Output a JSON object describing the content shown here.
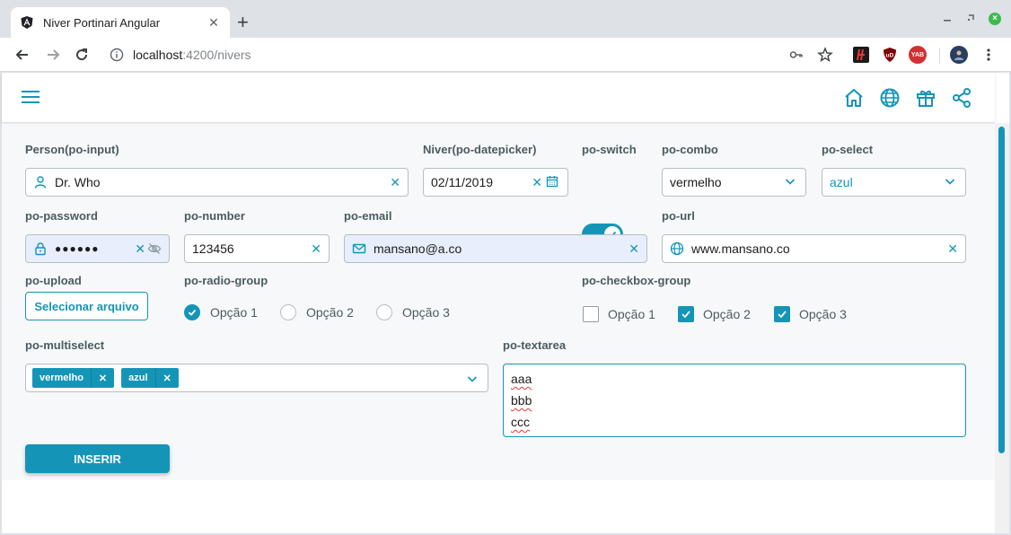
{
  "browser": {
    "tab_title": "Niver Portinari Angular",
    "tab_close": "✕",
    "new_tab": "+",
    "url_host": "localhost",
    "url_path": ":4200/nivers",
    "extensions": [
      "password-key",
      "bookmark-star",
      "ext-red",
      "ublock",
      "yab",
      "profile"
    ],
    "ext_ublock_text": "uD",
    "ext_yab_text": "YAB"
  },
  "header": {
    "icons": [
      "menu-icon",
      "home-icon",
      "globe-icon",
      "gift-icon",
      "share-icon"
    ]
  },
  "form": {
    "person": {
      "label": "Person(po-input)",
      "value": "Dr. Who"
    },
    "niver": {
      "label": "Niver(po-datepicker)",
      "value": "02/11/2019"
    },
    "switch": {
      "label": "po-switch",
      "on": true
    },
    "combo": {
      "label": "po-combo",
      "value": "vermelho"
    },
    "select": {
      "label": "po-select",
      "value": "azul"
    },
    "password": {
      "label": "po-password",
      "value": "●●●●●●"
    },
    "number": {
      "label": "po-number",
      "value": "123456"
    },
    "email": {
      "label": "po-email",
      "value": "mansano@a.co"
    },
    "url": {
      "label": "po-url",
      "value": "www.mansano.co"
    },
    "upload": {
      "label": "po-upload",
      "button": "Selecionar arquivo"
    },
    "radio": {
      "label": "po-radio-group",
      "options": [
        "Opção 1",
        "Opção 2",
        "Opção 3"
      ],
      "selected": 0
    },
    "checkbox": {
      "label": "po-checkbox-group",
      "options": [
        "Opção 1",
        "Opção 2",
        "Opção 3"
      ],
      "checked": [
        false,
        true,
        true
      ]
    },
    "multiselect": {
      "label": "po-multiselect",
      "tags": [
        "vermelho",
        "azul"
      ]
    },
    "textarea": {
      "label": "po-textarea",
      "lines": [
        "aaa",
        "bbb",
        "ccc"
      ]
    },
    "submit": "INSERIR"
  },
  "colors": {
    "accent": "#1495b8",
    "label": "#4a5c60",
    "border": "#b6bfc2",
    "highlight": "#e8eefb"
  }
}
